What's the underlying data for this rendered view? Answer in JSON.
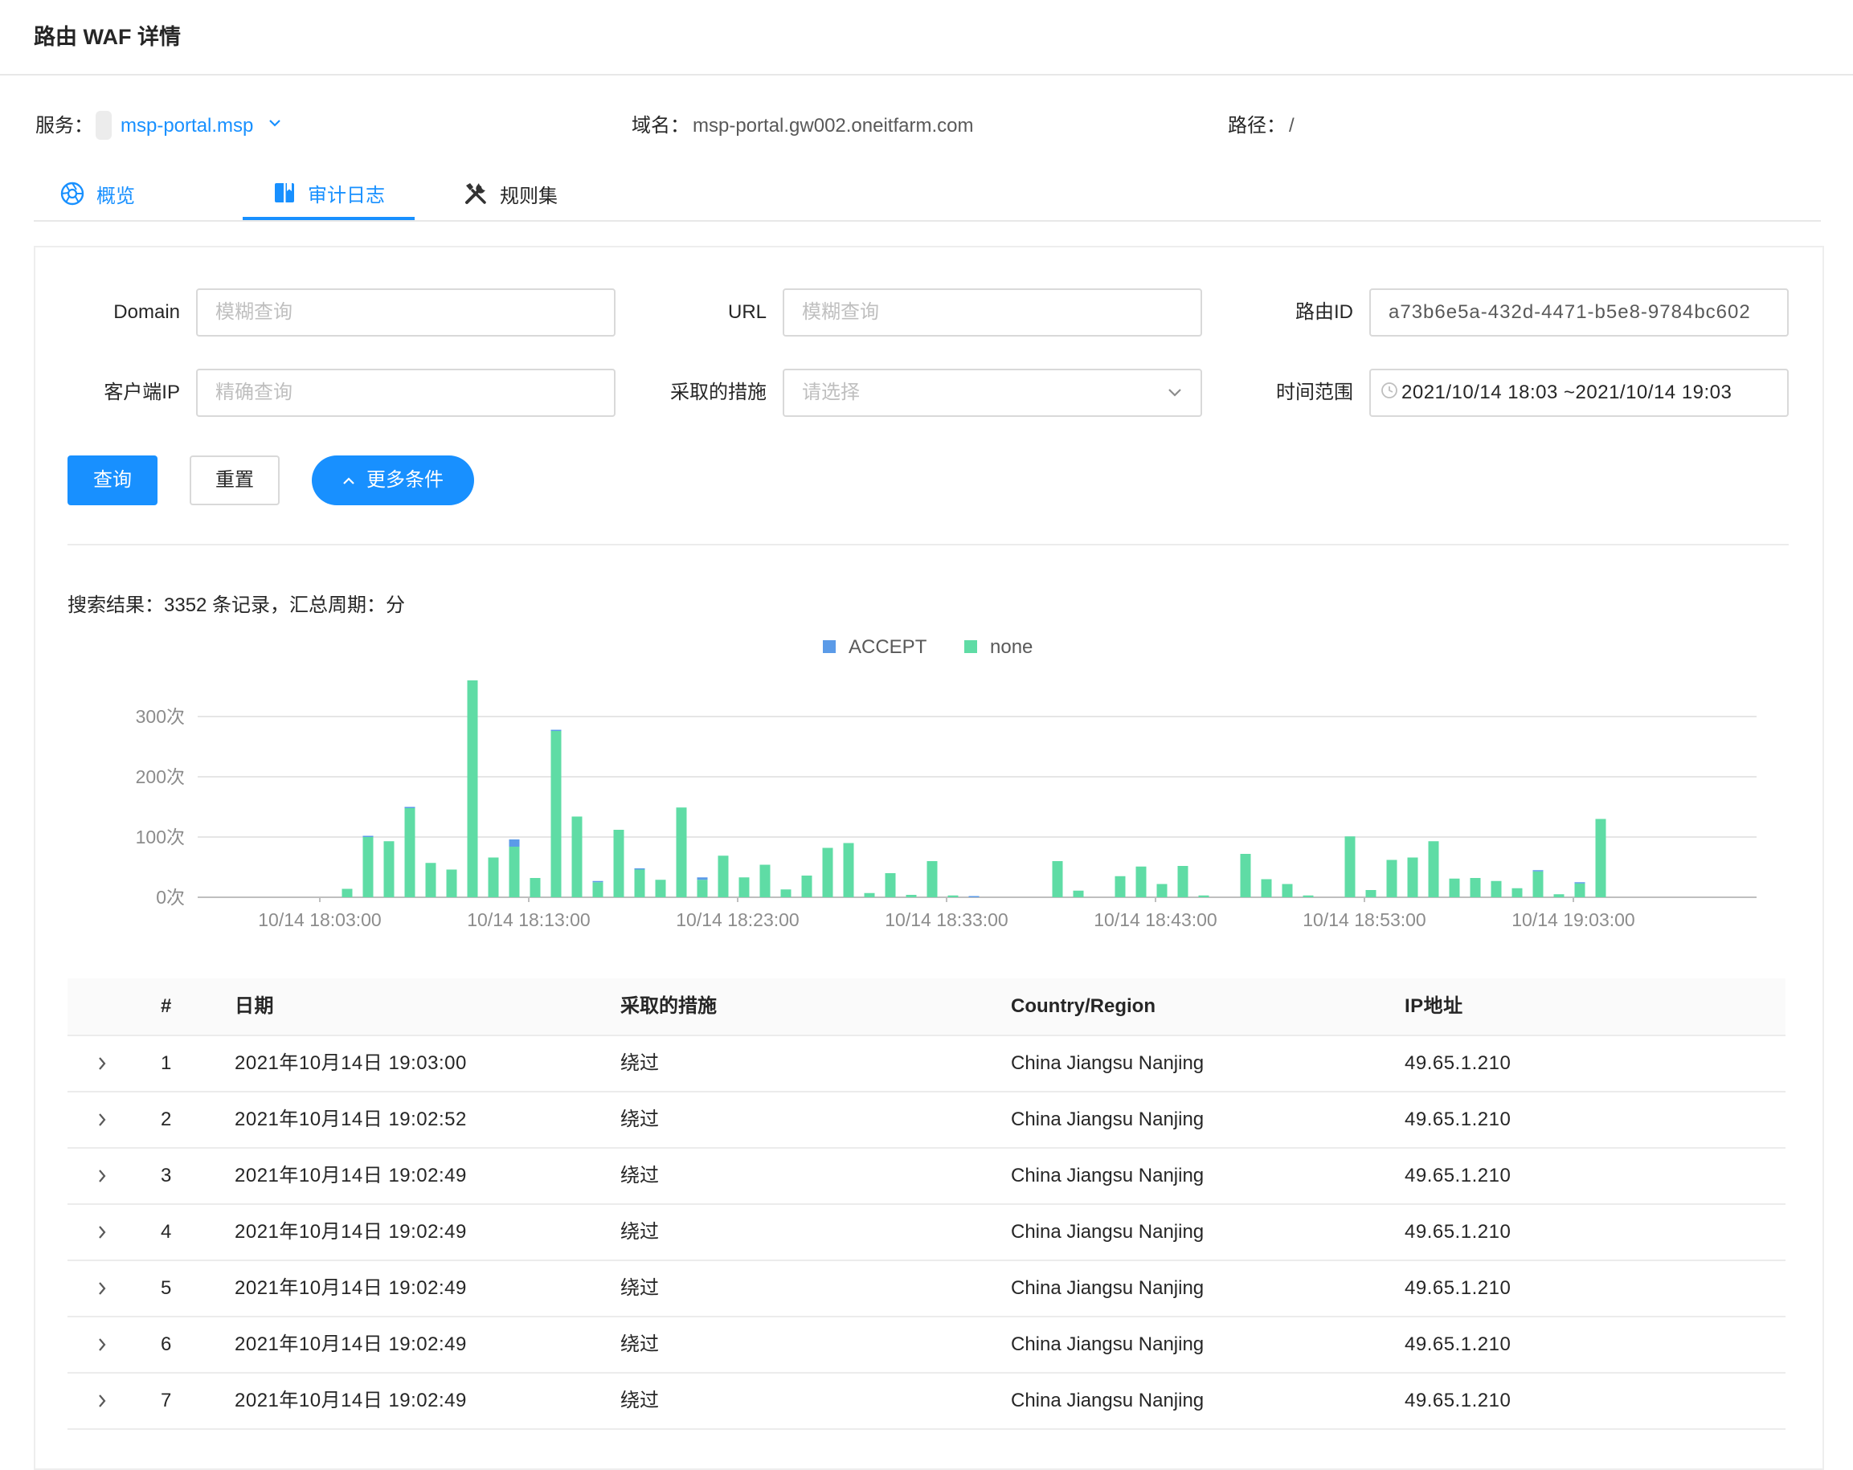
{
  "page": {
    "title": "路由 WAF 详情"
  },
  "info": {
    "service_label": "服务：",
    "service_value": "msp-portal.msp",
    "domain_label": "域名：",
    "domain_value": "msp-portal.gw002.oneitfarm.com",
    "path_label": "路径：",
    "path_value": "/"
  },
  "tabs": [
    {
      "label": "概览",
      "icon": "aperture-icon",
      "active": false
    },
    {
      "label": "审计日志",
      "icon": "book-icon",
      "active": true
    },
    {
      "label": "规则集",
      "icon": "tools-icon",
      "active": false
    }
  ],
  "filters": {
    "domain_label": "Domain",
    "domain_placeholder": "模糊查询",
    "url_label": "URL",
    "url_placeholder": "模糊查询",
    "route_id_label": "路由ID",
    "route_id_value": "a73b6e5a-432d-4471-b5e8-9784bc602",
    "client_ip_label": "客户端IP",
    "client_ip_placeholder": "精确查询",
    "action_label": "采取的措施",
    "action_placeholder": "请选择",
    "time_label": "时间范围",
    "time_value": "2021/10/14 18:03 ~2021/10/14 19:03"
  },
  "buttons": {
    "query": "查询",
    "reset": "重置",
    "more": "更多条件"
  },
  "summary": "搜索结果：3352 条记录，汇总周期：分",
  "colors": {
    "accent": "#1890ff",
    "accept": "#5b9be8",
    "none": "#5fdca5"
  },
  "chart_data": {
    "type": "bar",
    "stacked": true,
    "legend": [
      "ACCEPT",
      "none"
    ],
    "legend_position": "top-center",
    "yticks": [
      "0次",
      "100次",
      "200次",
      "300次"
    ],
    "ylim": [
      0,
      375
    ],
    "xticks": [
      "10/14 18:03:00",
      "10/14 18:13:00",
      "10/14 18:23:00",
      "10/14 18:33:00",
      "10/14 18:43:00",
      "10/14 18:53:00",
      "10/14 19:03:00"
    ],
    "series": [
      {
        "name": "ACCEPT",
        "values": [
          0,
          2,
          0,
          2,
          0,
          0,
          0,
          0,
          12,
          0,
          2,
          0,
          2,
          0,
          2,
          0,
          0,
          4,
          0,
          0,
          0,
          0,
          0,
          0,
          0,
          0,
          0,
          0,
          0,
          0,
          2,
          0,
          0,
          0,
          0,
          0,
          0,
          0,
          0,
          0,
          0,
          0,
          0,
          0,
          0,
          0,
          0,
          0,
          0,
          0,
          0,
          0,
          0,
          0,
          0,
          0,
          0,
          2,
          0,
          2,
          0,
          0,
          0,
          0,
          0,
          0,
          0,
          0,
          0,
          0,
          0,
          0,
          0,
          0,
          0,
          2,
          0,
          0,
          0,
          0,
          0
        ]
      },
      {
        "name": "none",
        "values": [
          14,
          100,
          93,
          148,
          57,
          46,
          360,
          66,
          84,
          32,
          276,
          134,
          25,
          112,
          46,
          29,
          149,
          29,
          69,
          33,
          54,
          13,
          36,
          82,
          90,
          7,
          40,
          4,
          60,
          3,
          0,
          0,
          0,
          0,
          60,
          11,
          0,
          35,
          51,
          22,
          52,
          3,
          0,
          72,
          30,
          22,
          3,
          0,
          101,
          12,
          62,
          66,
          93,
          31,
          32,
          27,
          15,
          43,
          5,
          23,
          130,
          0
        ]
      }
    ]
  },
  "table": {
    "columns": [
      "#",
      "日期",
      "采取的措施",
      "Country/Region",
      "IP地址"
    ],
    "rows": [
      {
        "idx": "1",
        "date": "2021年10月14日 19:03:00",
        "action": "绕过",
        "country": "China Jiangsu Nanjing",
        "ip": "49.65.1.210"
      },
      {
        "idx": "2",
        "date": "2021年10月14日 19:02:52",
        "action": "绕过",
        "country": "China Jiangsu Nanjing",
        "ip": "49.65.1.210"
      },
      {
        "idx": "3",
        "date": "2021年10月14日 19:02:49",
        "action": "绕过",
        "country": "China Jiangsu Nanjing",
        "ip": "49.65.1.210"
      },
      {
        "idx": "4",
        "date": "2021年10月14日 19:02:49",
        "action": "绕过",
        "country": "China Jiangsu Nanjing",
        "ip": "49.65.1.210"
      },
      {
        "idx": "5",
        "date": "2021年10月14日 19:02:49",
        "action": "绕过",
        "country": "China Jiangsu Nanjing",
        "ip": "49.65.1.210"
      },
      {
        "idx": "6",
        "date": "2021年10月14日 19:02:49",
        "action": "绕过",
        "country": "China Jiangsu Nanjing",
        "ip": "49.65.1.210"
      },
      {
        "idx": "7",
        "date": "2021年10月14日 19:02:49",
        "action": "绕过",
        "country": "China Jiangsu Nanjing",
        "ip": "49.65.1.210"
      }
    ]
  }
}
